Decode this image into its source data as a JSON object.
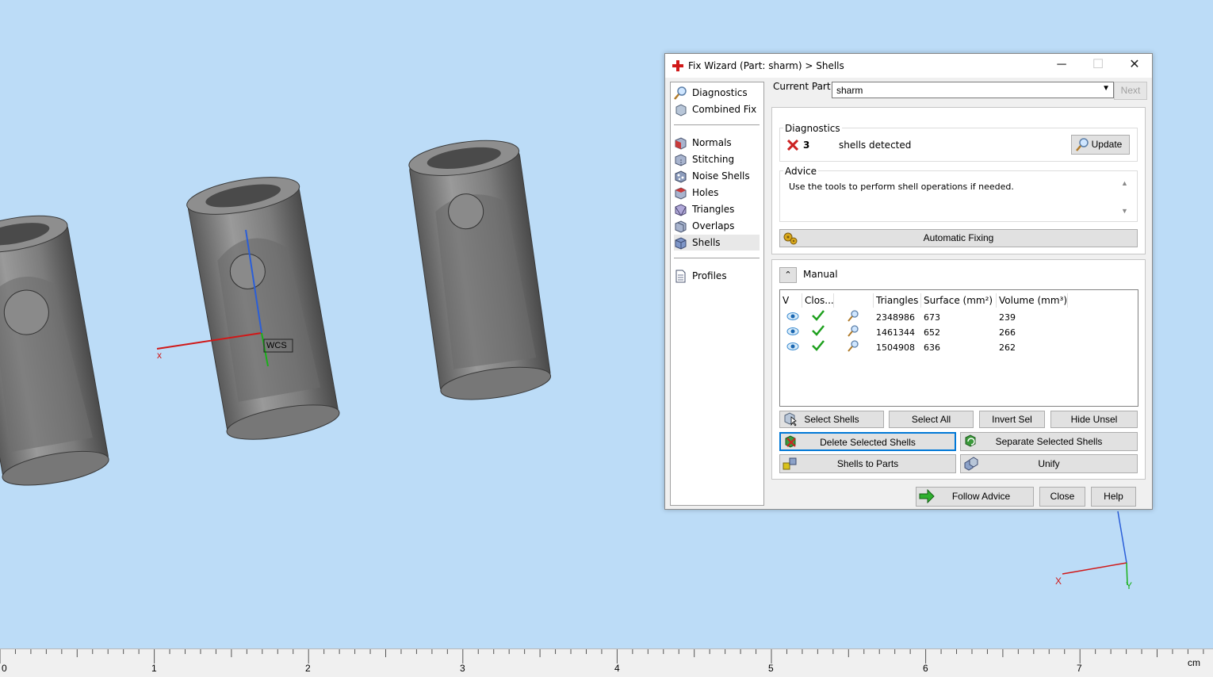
{
  "viewport": {
    "axis_x_label": "x",
    "wcs_label": "WCS",
    "corner_axes": {
      "x_label": "X",
      "y_label": "Y"
    }
  },
  "ruler": {
    "ticks": [
      "0",
      "1",
      "2",
      "3",
      "4",
      "5",
      "6",
      "7"
    ],
    "unit": "cm"
  },
  "dialog": {
    "title": "Fix Wizard (Part: sharm) > Shells",
    "window_buttons": {
      "minimize": "─",
      "maximize": "☐",
      "close": "✕"
    },
    "nav": {
      "items_top": [
        {
          "label": "Diagnostics",
          "icon": "magnifier-icon"
        },
        {
          "label": "Combined Fix",
          "icon": "cube-icon"
        }
      ],
      "items_mid": [
        {
          "label": "Normals",
          "icon": "normals-cube-icon"
        },
        {
          "label": "Stitching",
          "icon": "stitching-cube-icon"
        },
        {
          "label": "Noise Shells",
          "icon": "noise-shells-icon"
        },
        {
          "label": "Holes",
          "icon": "holes-cube-icon"
        },
        {
          "label": "Triangles",
          "icon": "triangles-cube-icon"
        },
        {
          "label": "Overlaps",
          "icon": "overlaps-cube-icon"
        },
        {
          "label": "Shells",
          "icon": "shells-cube-icon",
          "selected": true
        }
      ],
      "items_bottom": [
        {
          "label": "Profiles",
          "icon": "document-icon"
        }
      ]
    },
    "current_part_label": "Current Part:",
    "current_part_value": "sharm",
    "next_button": "Next",
    "diagnostics": {
      "title": "Diagnostics",
      "count": "3",
      "message": "shells detected",
      "update_button": "Update"
    },
    "advice": {
      "title": "Advice",
      "text": "Use the tools to perform shell operations if needed."
    },
    "automatic_fixing_button": "Automatic Fixing",
    "manual": {
      "title": "Manual",
      "columns": [
        "V",
        "Clos...",
        "",
        "Triangles",
        "Surface (mm²)",
        "Volume (mm³)"
      ],
      "rows": [
        {
          "triangles": "2348986",
          "surface": "673",
          "volume": "239"
        },
        {
          "triangles": "1461344",
          "surface": "652",
          "volume": "266"
        },
        {
          "triangles": "1504908",
          "surface": "636",
          "volume": "262"
        }
      ],
      "buttons": {
        "select_shells": "Select Shells",
        "select_all": "Select All",
        "invert_sel": "Invert Sel",
        "hide_unsel": "Hide Unsel",
        "delete_selected": "Delete Selected Shells",
        "separate_selected": "Separate Selected Shells",
        "shells_to_parts": "Shells to Parts",
        "unify": "Unify"
      }
    },
    "footer": {
      "follow_advice": "Follow Advice",
      "close": "Close",
      "help": "Help"
    },
    "colors": {
      "accent": "#0078d7",
      "error_red": "#cc2222",
      "check_green": "#1ea01e"
    }
  }
}
